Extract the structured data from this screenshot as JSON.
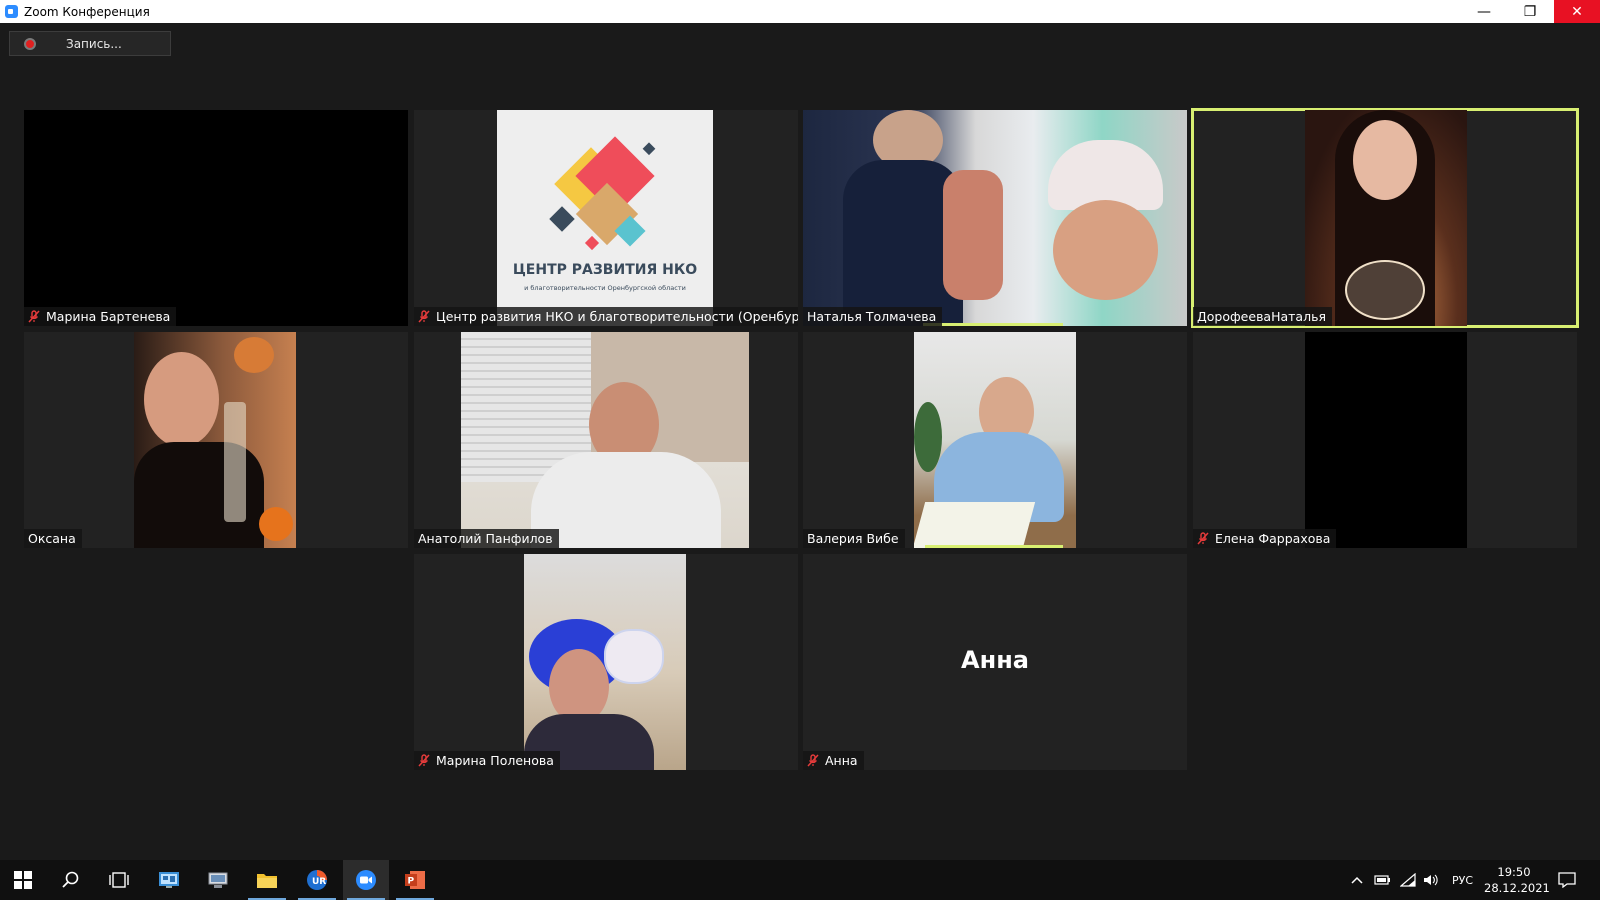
{
  "window": {
    "title": "Zoom Конференция",
    "minimize_glyph": "—",
    "maximize_glyph": "❐",
    "close_glyph": "✕"
  },
  "toolbar": {
    "record_label": "Запись..."
  },
  "participants": [
    {
      "name": "Марина Бартенева",
      "muted": true,
      "video": "off"
    },
    {
      "name": "Центр развития НКО и благотворительности (Оренбург)",
      "muted": true,
      "video": "logo",
      "logo_title": "ЦЕНТР РАЗВИТИЯ НКО",
      "logo_subtitle": "и благотворительности Оренбургской области"
    },
    {
      "name": "Наталья Толмачева",
      "muted": false,
      "video": "on"
    },
    {
      "name": "ДорофееваНаталья",
      "muted": false,
      "video": "on",
      "active_speaker": true
    },
    {
      "name": "Оксана",
      "muted": false,
      "video": "on"
    },
    {
      "name": "Анатолий Панфилов",
      "muted": false,
      "video": "on"
    },
    {
      "name": "Валерия Вибе",
      "muted": false,
      "video": "on"
    },
    {
      "name": "Елена Фаррахова",
      "muted": true,
      "video": "off"
    },
    {
      "name": "Марина Поленова",
      "muted": true,
      "video": "on"
    },
    {
      "name": "Анна",
      "muted": true,
      "video": "avatar-name",
      "display_name": "Анна"
    }
  ],
  "colors": {
    "active_speaker": "#d8ef72",
    "mute_icon": "#e53b3b",
    "close_button": "#e81123"
  },
  "taskbar": {
    "apps": [
      "windows-start",
      "search",
      "task-view",
      "control-panel",
      "device-manager",
      "file-explorer",
      "ur-browser",
      "zoom",
      "powerpoint"
    ],
    "language": "РУС",
    "time": "19:50",
    "date": "28.12.2021"
  }
}
